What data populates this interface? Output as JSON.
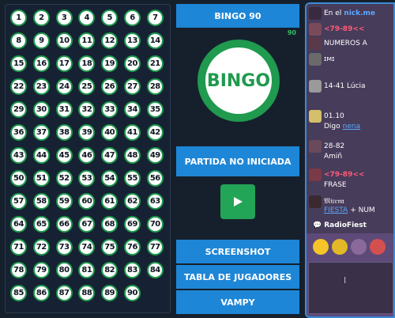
{
  "board": {
    "numbers": [
      "1",
      "2",
      "3",
      "4",
      "5",
      "6",
      "7",
      "8",
      "9",
      "10",
      "11",
      "12",
      "13",
      "14",
      "15",
      "16",
      "17",
      "18",
      "19",
      "20",
      "21",
      "22",
      "23",
      "24",
      "25",
      "26",
      "27",
      "28",
      "29",
      "30",
      "31",
      "32",
      "33",
      "34",
      "35",
      "36",
      "37",
      "38",
      "39",
      "40",
      "41",
      "42",
      "43",
      "44",
      "45",
      "46",
      "47",
      "48",
      "49",
      "50",
      "51",
      "52",
      "53",
      "54",
      "55",
      "56",
      "57",
      "58",
      "59",
      "60",
      "61",
      "62",
      "63",
      "64",
      "65",
      "66",
      "67",
      "68",
      "69",
      "70",
      "71",
      "72",
      "73",
      "74",
      "75",
      "76",
      "77",
      "78",
      "79",
      "80",
      "81",
      "82",
      "83",
      "84",
      "85",
      "86",
      "87",
      "88",
      "89",
      "90"
    ]
  },
  "game": {
    "title": "BINGO 90",
    "count": "90",
    "ball_label": "BINGO",
    "status_label": "PARTIDA NO INICIADA",
    "screenshot_label": "SCREENSHOT",
    "players_table_label": "TABLA DE JUGADORES",
    "vampy_label": "VAMPY",
    "accent_green": "#1f9a4e",
    "button_blue": "#1e86d6"
  },
  "chat": {
    "messages": [
      {
        "text": "En el",
        "extra": "nick.me"
      },
      {
        "text": "<79-89<<"
      },
      {
        "text": "NUMEROS A"
      },
      {
        "text": "ɪᴍɪ"
      },
      {
        "text": "14-41 Lúcia"
      },
      {
        "text": "01.10"
      },
      {
        "text": "Digo",
        "extra": "nena"
      },
      {
        "text": "28-82"
      },
      {
        "text": "Amiñ"
      },
      {
        "text": "<79-89<<"
      },
      {
        "text": "FRASE"
      },
      {
        "text": "𝔐𝔦𝔯𝔢𝔫𝔞"
      },
      {
        "text": "FIESTA",
        "extra": "+ NUM"
      }
    ],
    "radio_label": "RadioFiest"
  }
}
